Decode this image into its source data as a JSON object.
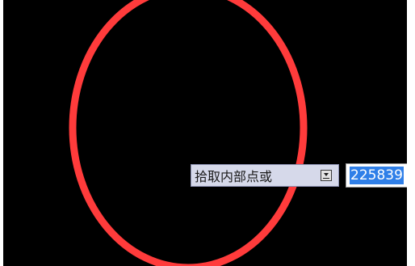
{
  "prompt": {
    "label": "拾取内部点或"
  },
  "value_field": {
    "value": "225839"
  },
  "colors": {
    "canvas_background": "#000000",
    "annotation_circle": "#ff3b3b",
    "prompt_background": "#d6d9ea",
    "selection_highlight": "#2f7fe8"
  }
}
